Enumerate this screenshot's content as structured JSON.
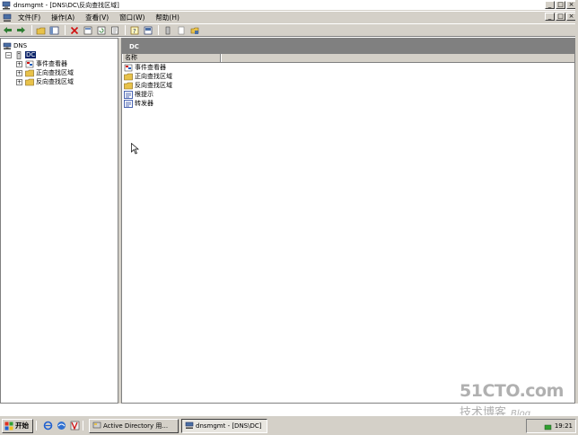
{
  "window": {
    "title": "dnsmgmt - [DNS\\DC\\反向查找区域]",
    "controls": [
      "_",
      "□",
      "×"
    ]
  },
  "menubar": {
    "items": [
      "文件(F)",
      "操作(A)",
      "查看(V)",
      "窗口(W)",
      "帮助(H)"
    ],
    "controls": [
      "_",
      "□",
      "×"
    ]
  },
  "tree": {
    "root": "DNS",
    "server": "DC",
    "children": [
      "事件查看器",
      "正向查找区域",
      "反向查找区域"
    ]
  },
  "right_pane": {
    "header": "DC",
    "column": "名称",
    "items": [
      "事件查看器",
      "正向查找区域",
      "反向查找区域",
      "根提示",
      "转发器"
    ]
  },
  "taskbar": {
    "start": "开始",
    "tasks": [
      "Active Directory 用...",
      "dnsmgmt - [DNS\\DC]"
    ],
    "clock": "19:21"
  },
  "watermark": {
    "site": "51CTO.com",
    "tagline": "技术博客",
    "blog": "Blog"
  },
  "colors": {
    "selection": "#0a246a",
    "face": "#d4d0c8",
    "header": "#808080"
  }
}
